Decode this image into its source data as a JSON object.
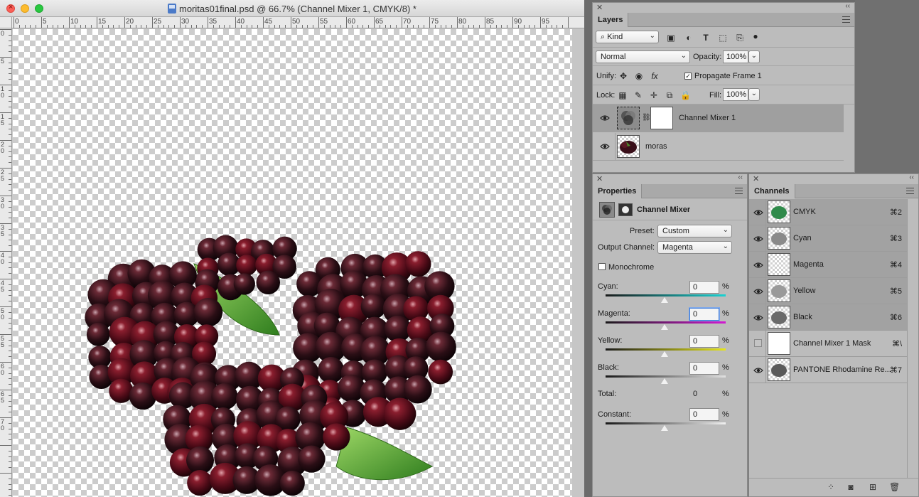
{
  "document": {
    "title": "moritas01final.psd @ 66.7% (Channel Mixer 1, CMYK/8) *",
    "ruler_top_labels": [
      "0",
      "5",
      "10",
      "15",
      "20",
      "25",
      "30",
      "35",
      "40",
      "45",
      "50",
      "55",
      "60",
      "65",
      "70",
      "75",
      "80",
      "85",
      "90",
      "95"
    ],
    "ruler_left_labels": [
      "0",
      "5",
      "10",
      "15",
      "20",
      "25",
      "30",
      "35",
      "40",
      "45",
      "50",
      "55",
      "60",
      "65",
      "70"
    ]
  },
  "layers_panel": {
    "tab": "Layers",
    "filter_kind": "Kind",
    "blend_mode": "Normal",
    "opacity_label": "Opacity:",
    "opacity_value": "100%",
    "unify_label": "Unify:",
    "propagate_label": "Propagate Frame 1",
    "lock_label": "Lock:",
    "fill_label": "Fill:",
    "fill_value": "100%",
    "layers": [
      {
        "name": "Channel Mixer 1",
        "selected": true
      },
      {
        "name": "moras",
        "selected": false
      }
    ]
  },
  "properties_panel": {
    "tab": "Properties",
    "title": "Channel Mixer",
    "preset_label": "Preset:",
    "preset_value": "Custom",
    "output_label": "Output Channel:",
    "output_value": "Magenta",
    "monochrome_label": "Monochrome",
    "sliders": [
      {
        "label": "Cyan:",
        "value": "0",
        "unit": "%",
        "colors": [
          "#1a1a1a",
          "#1ad2d2"
        ]
      },
      {
        "label": "Magenta:",
        "value": "0",
        "unit": "%",
        "colors": [
          "#1a1a1a",
          "#d21ad2"
        ]
      },
      {
        "label": "Yellow:",
        "value": "0",
        "unit": "%",
        "colors": [
          "#1a1a1a",
          "#e6e61a"
        ]
      },
      {
        "label": "Black:",
        "value": "0",
        "unit": "%",
        "colors": [
          "#1a1a1a",
          "#e0e0e0"
        ]
      }
    ],
    "total_label": "Total:",
    "total_value": "0",
    "total_unit": "%",
    "constant_label": "Constant:",
    "constant_value": "0",
    "constant_unit": "%"
  },
  "channels_panel": {
    "tab": "Channels",
    "channels": [
      {
        "name": "CMYK",
        "shortcut": "⌘2"
      },
      {
        "name": "Cyan",
        "shortcut": "⌘3"
      },
      {
        "name": "Magenta",
        "shortcut": "⌘4"
      },
      {
        "name": "Yellow",
        "shortcut": "⌘5"
      },
      {
        "name": "Black",
        "shortcut": "⌘6"
      },
      {
        "name": "Channel Mixer 1 Mask",
        "shortcut": "⌘\\"
      },
      {
        "name": "PANTONE Rhodamine Re...",
        "shortcut": "⌘7"
      }
    ]
  }
}
